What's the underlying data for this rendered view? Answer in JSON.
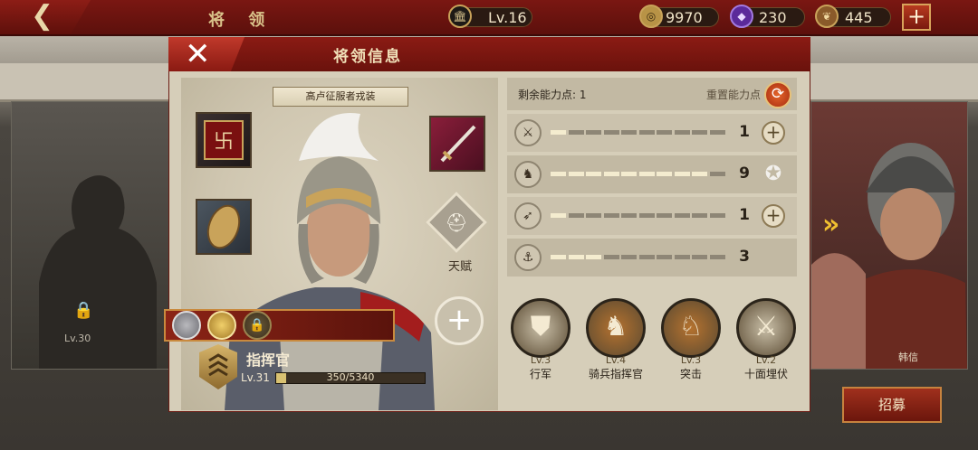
{
  "topbar": {
    "back_icon": "back-arrow-icon",
    "title": "将 领",
    "level_label": "Lv.16",
    "gold": "9970",
    "gems": "230",
    "food": "445",
    "add_icon": "plus-icon"
  },
  "dialog": {
    "title": "将领信息",
    "close_icon": "close-icon",
    "outfit_button": "高卢征服者戎装",
    "talent_label": "天赋",
    "commander": {
      "title": "指挥官",
      "level": "Lv.31",
      "xp_text": "350/5340",
      "xp_fraction": 0.066
    },
    "stats": {
      "remaining_label": "剩余能力点: 1",
      "reset_label": "重置能力点",
      "rows": [
        {
          "icon": "sword-icon",
          "value": "1",
          "filled": 1,
          "total": 10,
          "action": "plus"
        },
        {
          "icon": "horse-icon",
          "value": "9",
          "filled": 9,
          "total": 10,
          "action": "laurel"
        },
        {
          "icon": "bow-icon",
          "value": "1",
          "filled": 1,
          "total": 10,
          "action": "plus"
        },
        {
          "icon": "anchor-icon",
          "value": "3",
          "filled": 3,
          "total": 10,
          "action": "none"
        }
      ]
    },
    "skills": [
      {
        "level": "Lv.3",
        "name": "行军"
      },
      {
        "level": "Lv.4",
        "name": "骑兵指挥官"
      },
      {
        "level": "Lv.3",
        "name": "突击"
      },
      {
        "level": "Lv.2",
        "name": "十面埋伏"
      }
    ]
  },
  "background": {
    "left_lock_icon": "lock-icon",
    "left_level": "Lv.30",
    "right_name": "韩信",
    "recruit_label": "招募"
  },
  "colors": {
    "accent_red": "#8b1b14",
    "gold": "#d9c272",
    "panel": "#d6ceb9"
  }
}
